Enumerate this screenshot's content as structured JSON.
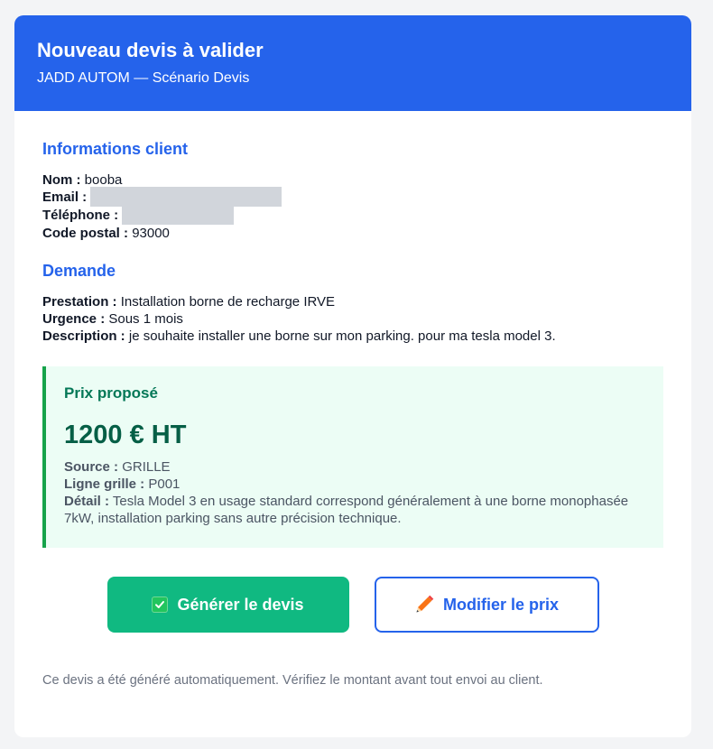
{
  "header": {
    "title": "Nouveau devis à valider",
    "subtitle": "JADD AUTOM — Scénario Devis"
  },
  "client": {
    "section_title": "Informations client",
    "name_label": "Nom :",
    "name_value": "booba",
    "email_label": "Email :",
    "phone_label": "Téléphone :",
    "postal_label": "Code postal :",
    "postal_value": "93000"
  },
  "request": {
    "section_title": "Demande",
    "service_label": "Prestation :",
    "service_value": "Installation borne de recharge IRVE",
    "urgency_label": "Urgence :",
    "urgency_value": "Sous 1 mois",
    "description_label": "Description :",
    "description_value": "je souhaite installer une borne sur mon parking. pour ma tesla model 3."
  },
  "price": {
    "title": "Prix proposé",
    "value": "1200 € HT",
    "source_label": "Source :",
    "source_value": "GRILLE",
    "grid_label": "Ligne grille :",
    "grid_value": "P001",
    "detail_label": "Détail :",
    "detail_value": "Tesla Model 3 en usage standard correspond généralement à une borne monophasée 7kW, installation parking sans autre précision technique."
  },
  "actions": {
    "generate_label": "Générer le devis",
    "generate_icon": "check-box-icon",
    "modify_label": "Modifier le prix",
    "modify_icon": "pencil-icon"
  },
  "footer": {
    "note": "Ce devis a été généré automatiquement. Vérifiez le montant avant tout envoi au client."
  },
  "colors": {
    "header_bg": "#2563eb",
    "accent_blue": "#2563eb",
    "price_bg": "#ecfdf5",
    "price_border": "#16a34a",
    "price_text": "#065f46",
    "primary_button": "#10b981"
  }
}
